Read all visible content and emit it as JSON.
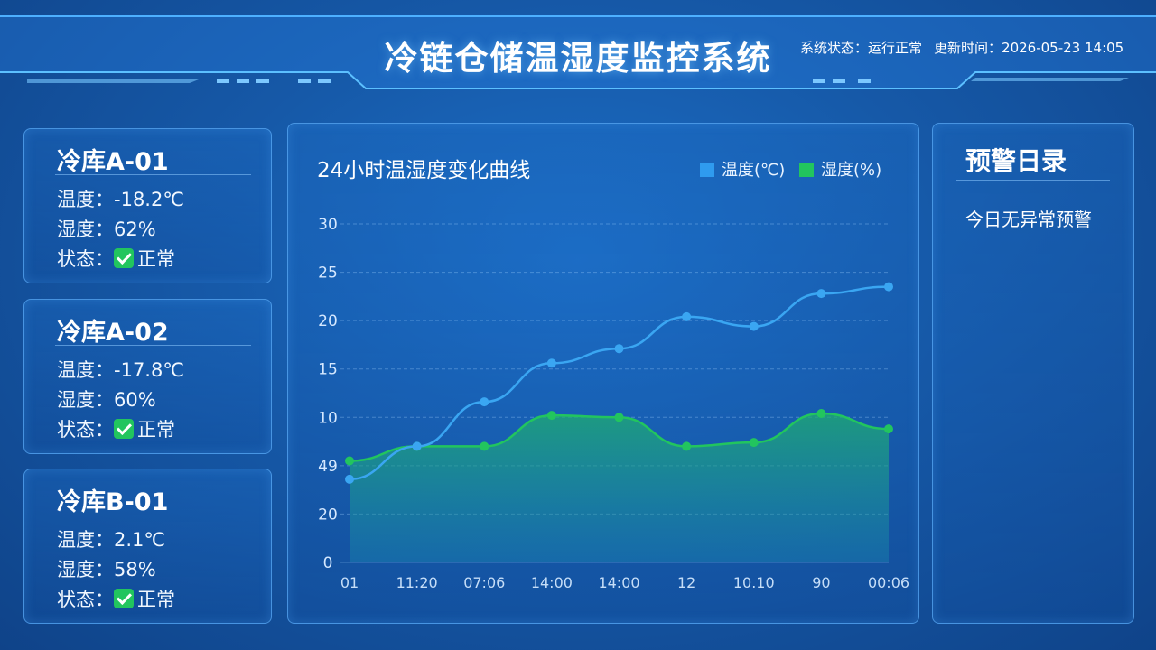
{
  "header": {
    "title": "冷链仓储温湿度监控系统",
    "status_label": "系统状态：",
    "status_value": "运行正常",
    "update_label": "更新时间：",
    "update_value": "2026-05-23 14:05"
  },
  "stores": [
    {
      "name": "冷库A-01",
      "temp_label": "温度：",
      "temp": "-18.2℃",
      "hum_label": "湿度：",
      "hum": "62%",
      "status_label": "状态：",
      "status": "正常"
    },
    {
      "name": "冷库A-02",
      "temp_label": "温度：",
      "temp": "-17.8℃",
      "hum_label": "湿度：",
      "hum": "60%",
      "status_label": "状态：",
      "status": "正常"
    },
    {
      "name": "冷库B-01",
      "temp_label": "温度：",
      "temp": "2.1℃",
      "hum_label": "湿度：",
      "hum": "58%",
      "status_label": "状态：",
      "status": "正常"
    }
  ],
  "colors": {
    "temp": "#2f9bef",
    "hum": "#22c55e",
    "accent": "#5ab4ff"
  },
  "chart_data": {
    "type": "area",
    "title": "24小时温湿度变化曲线",
    "legend": [
      "温度(℃)",
      "湿度(%)"
    ],
    "y_ticks": [
      "0",
      "20",
      "49",
      "10",
      "15",
      "20",
      "25",
      "30"
    ],
    "x_ticks": [
      "01",
      "11:20",
      "07:06",
      "14:00",
      "14:00",
      "12",
      "10.10",
      "90",
      "00:06"
    ],
    "ylim": [
      0,
      35
    ],
    "series": [
      {
        "name": "温度(℃)",
        "type": "line",
        "values": [
          8.6,
          12,
          16.6,
          20.6,
          22.1,
          25.4,
          24.4,
          27.8,
          28.5
        ]
      },
      {
        "name": "湿度(%)",
        "type": "area",
        "values": [
          10.5,
          12,
          12,
          15.2,
          15,
          12,
          12.4,
          15.4,
          13.8
        ]
      }
    ],
    "grid": true,
    "legend_position": "top-right"
  },
  "alerts": {
    "title": "预警日录",
    "message": "今日无异常预警"
  }
}
